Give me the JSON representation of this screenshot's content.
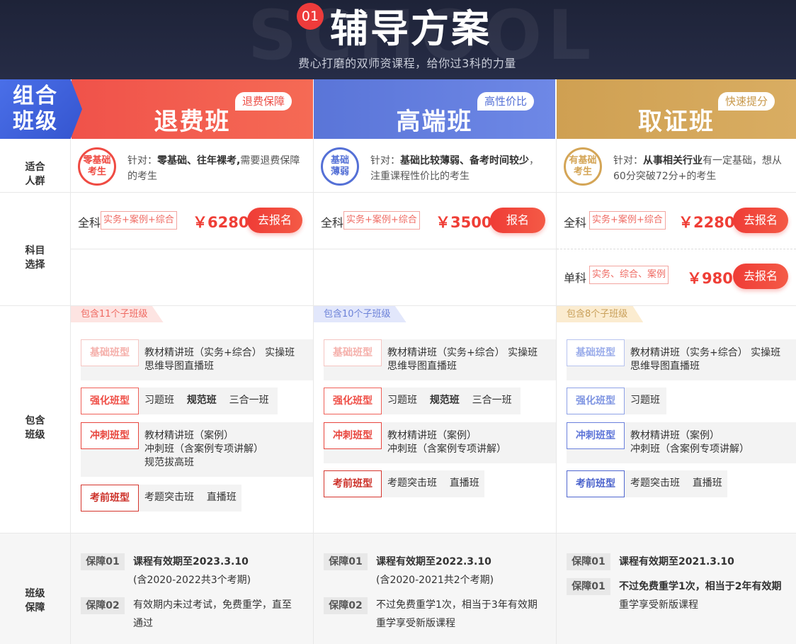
{
  "header": {
    "badge": "01",
    "title": "辅导方案",
    "subtitle": "费心打磨的双师资课程，给你过3科的力量",
    "watermark": "SCHOOL"
  },
  "group_label": {
    "line1": "组合",
    "line2": "班级"
  },
  "columns": [
    {
      "name": "退费班",
      "tag": "退费保障",
      "color": "#f0524a"
    },
    {
      "name": "高端班",
      "tag": "高性价比",
      "color": "#5a75d8"
    },
    {
      "name": "取证班",
      "tag": "快速提分",
      "color": "#cfa052"
    }
  ],
  "row_labels": {
    "suitable": {
      "l1": "适合",
      "l2": "人群"
    },
    "subject": {
      "l1": "科目",
      "l2": "选择"
    },
    "classes": {
      "l1": "包含",
      "l2": "班级"
    },
    "guarantee": {
      "l1": "班级",
      "l2": "保障"
    }
  },
  "suitable": [
    {
      "ring_l1": "零基础",
      "ring_l2": "考生",
      "prefix": "针对：",
      "bold": "零基础、往年裸考,",
      "rest": "需要退费保障",
      "line2": "的考生"
    },
    {
      "ring_l1": "基础",
      "ring_l2": "薄弱",
      "prefix": "针对：",
      "bold": "基础比较薄弱、备考时间较少",
      "rest": "，",
      "line2": "注重课程性价比的考生"
    },
    {
      "ring_l1": "有基础",
      "ring_l2": "考生",
      "prefix": "针对：",
      "bold": "从事相关行业",
      "rest": "有一定基础，想从",
      "line2": "60分突破72分+的考生"
    }
  ],
  "pricing": [
    {
      "label": "全科",
      "subjects": "实务+案例+综合",
      "price": "￥6280",
      "button": "去报名"
    },
    {
      "label": "全科",
      "subjects": "实务+案例+综合",
      "price": "￥3500",
      "button": "报名"
    },
    {
      "label": "全科",
      "subjects": "实务+案例+综合",
      "price": "￥2280",
      "button": "去报名"
    },
    {
      "label": "单科",
      "subjects": "实务、综合、案例",
      "price": "￥980",
      "button": "去报名"
    }
  ],
  "class_counts": [
    "包含11个子班级",
    "包含10个子班级",
    "包含8个子班级"
  ],
  "class_types": {
    "basic": "基础班型",
    "strengthen": "强化班型",
    "sprint": "冲刺班型",
    "pre_exam": "考前班型"
  },
  "classes": {
    "c1": {
      "basic_l1": "教材精讲班（实务+综合）   实操班",
      "basic_l2": "思维导图直播班",
      "str_a": "习题班",
      "str_b": "规范班",
      "str_c": "三合一班",
      "spr_l1": "教材精讲班（案例）",
      "spr_l2": "冲刺班（含案例专项讲解）",
      "spr_l3": "规范拔高班",
      "pre_a": "考题突击班",
      "pre_b": "直播班"
    },
    "c2": {
      "basic_l1": "教材精讲班（实务+综合）   实操班",
      "basic_l2": "思维导图直播班",
      "str_a": "习题班",
      "str_b": "规范班",
      "str_c": "三合一班",
      "spr_l1": "教材精讲班（案例）",
      "spr_l2": "冲刺班（含案例专项讲解）",
      "pre_a": "考题突击班",
      "pre_b": "直播班"
    },
    "c3": {
      "basic_l1": "教材精讲班（实务+综合）   实操班",
      "basic_l2": "思维导图直播班",
      "str_a": "习题班",
      "spr_l1": "教材精讲班（案例）",
      "spr_l2": "冲刺班（含案例专项讲解）",
      "pre_a": "考题突击班",
      "pre_b": "直播班"
    }
  },
  "guarantees": {
    "c1": [
      {
        "badge": "保障01",
        "l1": "课程有效期至2023.3.10",
        "l2": "(含2020-2022共3个考期)"
      },
      {
        "badge": "保障02",
        "l1": "有效期内未过考试，免费重学，直至",
        "l2": "通过"
      }
    ],
    "c2": [
      {
        "badge": "保障01",
        "l1": "课程有效期至2022.3.10",
        "l2": "(含2020-2021共2个考期)"
      },
      {
        "badge": "保障02",
        "l1": "不过免费重学1次，相当于3年有效期",
        "l2": "重学享受新版课程"
      }
    ],
    "c3": [
      {
        "badge": "保障01",
        "l1": "课程有效期至2021.3.10"
      },
      {
        "badge": "保障01",
        "l1": "不过免费重学1次，相当于2年有效期",
        "l2": "重学享受新版课程"
      }
    ]
  }
}
